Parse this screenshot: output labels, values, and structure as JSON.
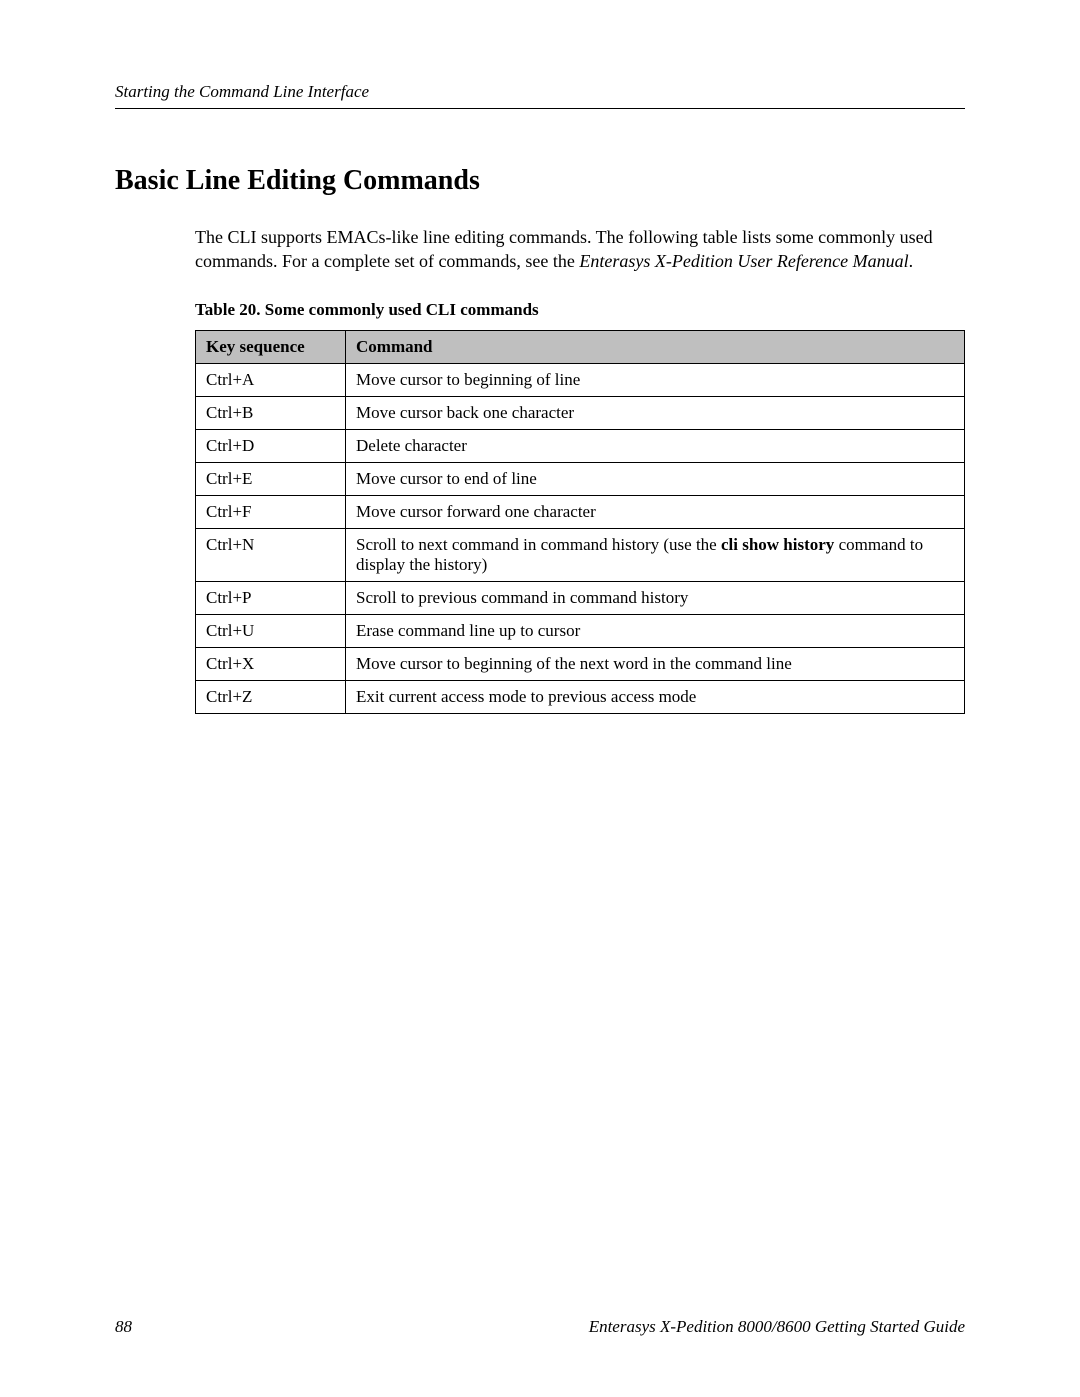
{
  "header": {
    "running_head": "Starting the Command Line Interface"
  },
  "section": {
    "title": "Basic Line Editing Commands",
    "intro_before": "The CLI supports EMACs-like line editing commands. The following table lists some commonly used commands. For a complete set of commands, see the ",
    "intro_em": "Enterasys X-Pedition User Reference Manual",
    "intro_after": "."
  },
  "table": {
    "caption": "Table 20.  Some commonly used CLI commands",
    "head_key": "Key sequence",
    "head_cmd": "Command",
    "rows": [
      {
        "key": "Ctrl+A",
        "cmd": "Move cursor to beginning of line"
      },
      {
        "key": "Ctrl+B",
        "cmd": "Move cursor back one character"
      },
      {
        "key": "Ctrl+D",
        "cmd": "Delete character"
      },
      {
        "key": "Ctrl+E",
        "cmd": "Move cursor to end of line"
      },
      {
        "key": "Ctrl+F",
        "cmd": "Move cursor forward one character"
      },
      {
        "key": "Ctrl+N",
        "cmd_before": "Scroll to next command in command history (use the ",
        "cmd_bold": "cli show history",
        "cmd_after": " command to display the history)"
      },
      {
        "key": "Ctrl+P",
        "cmd": "Scroll to previous command in command history"
      },
      {
        "key": "Ctrl+U",
        "cmd": "Erase command line up to cursor"
      },
      {
        "key": "Ctrl+X",
        "cmd": "Move cursor to beginning of the next word in the command line"
      },
      {
        "key": "Ctrl+Z",
        "cmd": "Exit current access mode to previous access mode"
      }
    ]
  },
  "footer": {
    "page_number": "88",
    "book_title": "Enterasys X-Pedition 8000/8600 Getting Started Guide"
  }
}
